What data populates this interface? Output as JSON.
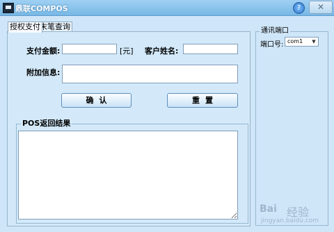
{
  "window": {
    "title": "鼎联COMPOS",
    "close_label": "✕",
    "help_label": "?"
  },
  "tabs": [
    {
      "label": "授权支付"
    },
    {
      "label": "末笔查询"
    }
  ],
  "form": {
    "amount_label": "支付金额:",
    "amount_value": "",
    "unit_label": "[元]",
    "customer_label": "客户姓名:",
    "customer_value": "",
    "extra_label": "附加信息:",
    "extra_value": "",
    "confirm_label": "确认",
    "reset_label": "重置"
  },
  "result_group": {
    "title": "POS返回结果",
    "value": ""
  },
  "comm": {
    "title": "通讯端口",
    "port_label": "端口号:",
    "port_value": "com1"
  },
  "watermark": {
    "logo": "Bai",
    "text": "经验",
    "url": "jingyan.baidu.com"
  },
  "icons": {
    "app": "app-icon",
    "help": "help-icon",
    "close": "close-icon",
    "dropdown": "chevron-down-icon"
  }
}
